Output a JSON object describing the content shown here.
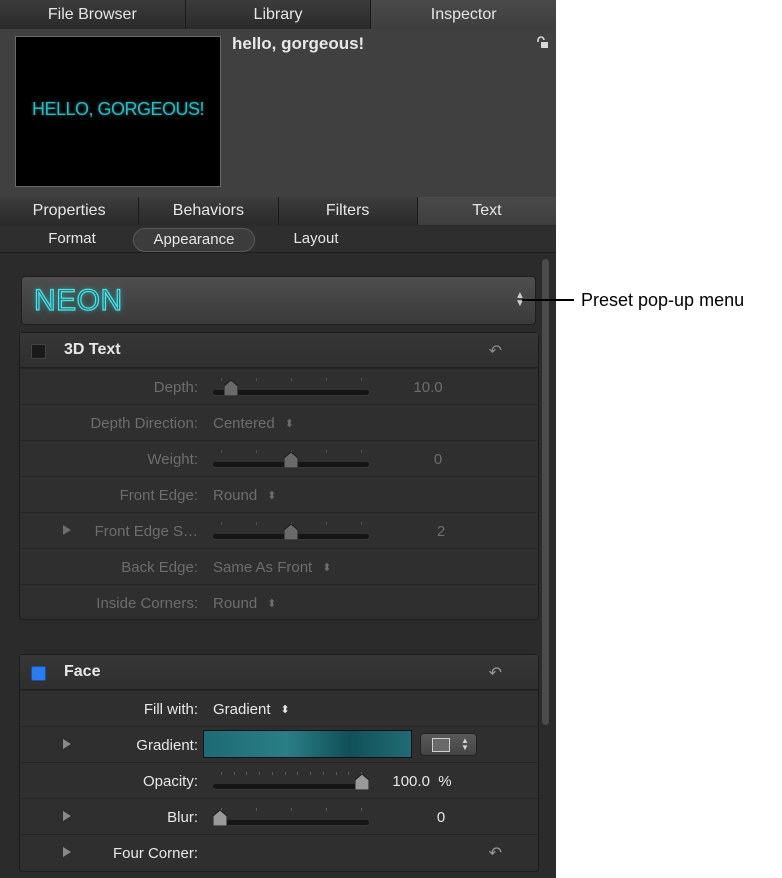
{
  "top_tabs": [
    {
      "label": "File Browser"
    },
    {
      "label": "Library"
    },
    {
      "label": "Inspector",
      "active": true
    }
  ],
  "header": {
    "title": "hello, gorgeous!",
    "preview_text": "HELLO, GORGEOUS!"
  },
  "inspector_tabs": [
    {
      "label": "Properties"
    },
    {
      "label": "Behaviors"
    },
    {
      "label": "Filters"
    },
    {
      "label": "Text",
      "active": true
    }
  ],
  "sub_tabs": [
    {
      "label": "Format"
    },
    {
      "label": "Appearance",
      "active": true
    },
    {
      "label": "Layout"
    }
  ],
  "preset": {
    "label": "NEON"
  },
  "annotation": {
    "text": "Preset pop-up menu"
  },
  "text3d": {
    "title": "3D Text",
    "enabled": false,
    "depth": {
      "label": "Depth:",
      "value": "10.0",
      "level": 0.08
    },
    "depth_direction": {
      "label": "Depth Direction:",
      "value": "Centered"
    },
    "weight": {
      "label": "Weight:",
      "value": "0",
      "level": 0.5
    },
    "front_edge": {
      "label": "Front Edge:",
      "value": "Round"
    },
    "front_edge_size": {
      "label": "Front Edge S…",
      "value": "2",
      "level": 0.5
    },
    "back_edge": {
      "label": "Back Edge:",
      "value": "Same As Front"
    },
    "inside_corners": {
      "label": "Inside Corners:",
      "value": "Round"
    }
  },
  "face": {
    "title": "Face",
    "enabled": true,
    "fill_with": {
      "label": "Fill with:",
      "value": "Gradient"
    },
    "gradient": {
      "label": "Gradient:"
    },
    "opacity": {
      "label": "Opacity:",
      "value": "100.0",
      "unit": "%",
      "level": 1.0
    },
    "blur": {
      "label": "Blur:",
      "value": "0",
      "level": 0.0
    },
    "four_corner": {
      "label": "Four Corner:"
    }
  },
  "colors": {
    "panel": "#2b2b2b",
    "accent_blue": "#2a7bf0",
    "neon_teal": "#3fc4c4",
    "gradient_teal": "#1e6e76"
  },
  "icons": [
    "lock-icon",
    "reset-arrow-icon",
    "disclosure-triangle-icon",
    "up-down-arrows-icon",
    "gradient-preset-icon"
  ]
}
